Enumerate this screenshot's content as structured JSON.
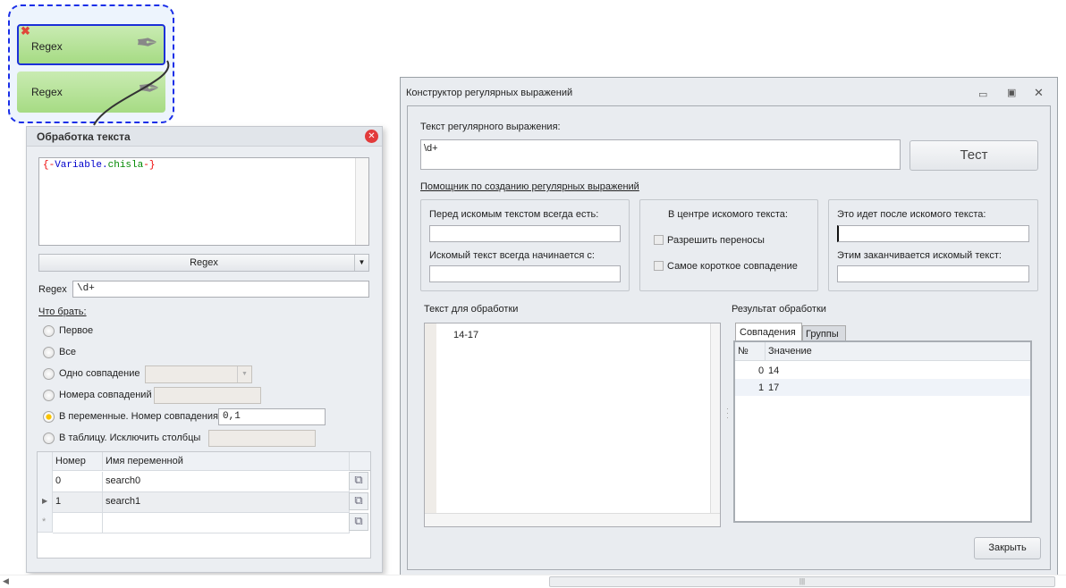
{
  "nodes": [
    {
      "label": "Regex",
      "selected": true
    },
    {
      "label": "Regex",
      "selected": false
    }
  ],
  "left_panel": {
    "title": "Обработка текста",
    "input_text": {
      "open": "{-",
      "var": "Variable.",
      "name": "chisla",
      "close": "-}"
    },
    "action_select": "Regex",
    "regex_label": "Regex",
    "regex_value": "\\d+",
    "what_label": "Что брать:",
    "options": [
      {
        "label": "Первое",
        "checked": false
      },
      {
        "label": "Все",
        "checked": false
      },
      {
        "label": "Одно совпадение",
        "checked": false
      },
      {
        "label": "Номера совпадений",
        "checked": false
      },
      {
        "label": "В переменные. Номер совпадения",
        "checked": true,
        "value": "0,1"
      },
      {
        "label": "В таблицу. Исключить столбцы",
        "checked": false
      }
    ],
    "table": {
      "headers": [
        "Номер",
        "Имя переменной"
      ],
      "rows": [
        [
          "0",
          "search0"
        ],
        [
          "1",
          "search1"
        ]
      ],
      "new_row_marker": "*"
    }
  },
  "dialog": {
    "title": "Конструктор регулярных выражений",
    "regex_label": "Текст регулярного выражения:",
    "regex_value": "\\d+",
    "test_button": "Тест",
    "helper_link": "Помощник по созданию регулярных выражений",
    "before_label": "Перед искомым текстом всегда есть:",
    "starts_label": "Искомый текст всегда начинается с:",
    "center_label": "В центре искомого текста:",
    "allow_wrap": "Разрешить переносы",
    "shortest": "Самое короткое совпадение",
    "after_label": "Это идет после искомого текста:",
    "ends_label": "Этим заканчивается искомый текст:",
    "text_label": "Текст для обработки",
    "text_value": "14-17",
    "result_label": "Результат обработки",
    "tabs": [
      "Совпадения",
      "Группы"
    ],
    "result_headers": [
      "№",
      "Значение"
    ],
    "results": [
      [
        "0",
        "14"
      ],
      [
        "1",
        "17"
      ]
    ],
    "close_button": "Закрыть"
  }
}
